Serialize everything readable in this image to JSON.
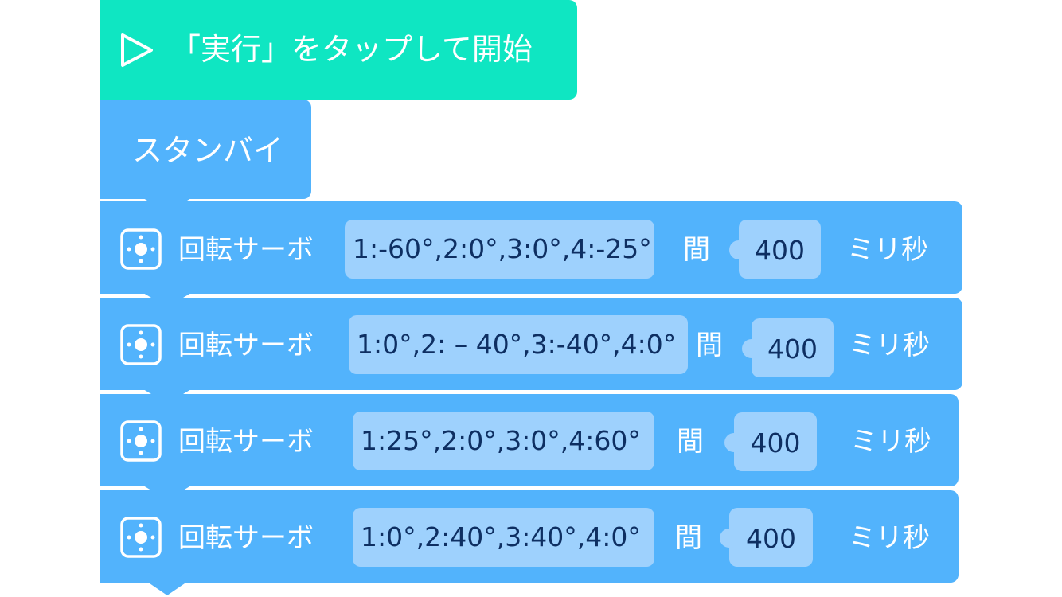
{
  "start": {
    "label": "「実行」をタップして開始",
    "icon": "play-icon",
    "color": "#0fe6c2"
  },
  "standby": {
    "label": "スタンバイ",
    "color": "#52b3fc"
  },
  "servo_blocks": [
    {
      "label": "回転サーボ",
      "angles": "1:-60°,2:0°,3:0°,4:-25°",
      "ma": "間",
      "time": "400",
      "unit": "ミリ秒"
    },
    {
      "label": "回転サーボ",
      "angles": "1:0°,2: – 40°,3:-40°,4:0°",
      "ma": "間",
      "time": "400",
      "unit": "ミリ秒"
    },
    {
      "label": "回転サーボ",
      "angles": "1:25°,2:0°,3:0°,4:60°",
      "ma": "間",
      "time": "400",
      "unit": "ミリ秒"
    },
    {
      "label": "回転サーボ",
      "angles": "1:0°,2:40°,3:40°,4:0°",
      "ma": "間",
      "time": "400",
      "unit": "ミリ秒"
    }
  ],
  "colors": {
    "block": "#52b3fc",
    "field": "#9ed1fd",
    "field_text": "#0e2f62"
  }
}
